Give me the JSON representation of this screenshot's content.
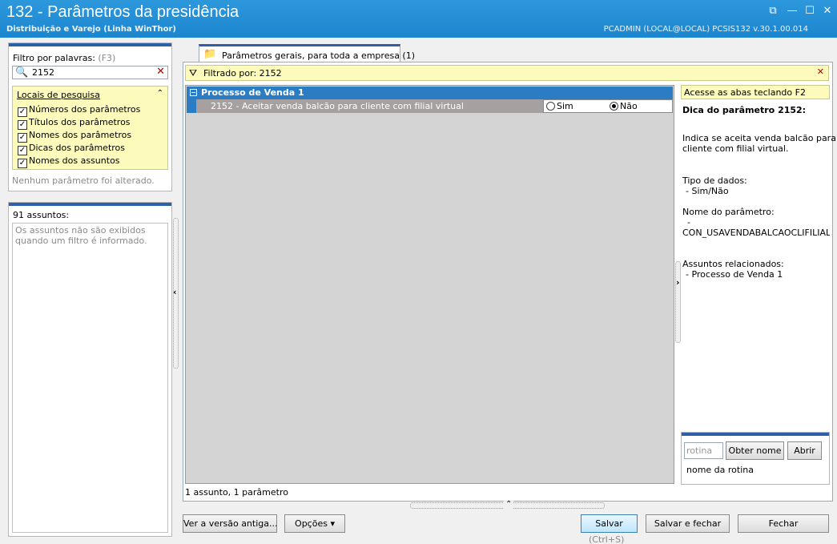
{
  "window": {
    "title": "132 - Parâmetros da presidência",
    "subtitle": "Distribuição e Varejo (Linha WinThor)",
    "user_info": "PCADMIN (LOCAL@LOCAL)   PCSIS132  v.30.1.00.014",
    "btn_restore": "⧉",
    "btn_minimize": "—",
    "btn_maximize": "☐",
    "btn_close": "✕"
  },
  "filter": {
    "label": "Filtro por palavras:",
    "shortcut": "(F3)",
    "search_value": "2152",
    "clear_glyph": "✕",
    "search_glyph": "🔍",
    "locations_header": "Locais de pesquisa",
    "collapse_glyph": "⌃",
    "locations": [
      {
        "label": "Números dos parâmetros",
        "checked": true
      },
      {
        "label": "Títulos dos parâmetros",
        "checked": true
      },
      {
        "label": "Nomes dos parâmetros",
        "checked": true
      },
      {
        "label": "Dicas dos parâmetros",
        "checked": true
      },
      {
        "label": "Nomes dos assuntos",
        "checked": true
      }
    ],
    "check_glyph": "✓",
    "no_change": "Nenhum parâmetro foi alterado."
  },
  "topics": {
    "count_label": "91 assuntos:",
    "message": "Os assuntos não são exibidos quando um filtro é informado."
  },
  "tab": {
    "label": "Parâmetros gerais, para toda a empresa  (1)",
    "icon": "📁"
  },
  "filterbar": {
    "text": "Filtrado por: 2152",
    "icon": "⛛",
    "close": "✕"
  },
  "grid": {
    "group_label": "Processo de Venda 1",
    "group_expander": "−",
    "param_label": "2152 - Aceitar venda balcão para cliente com filial virtual",
    "option_yes": "Sim",
    "option_no": "Não",
    "selected": "Não"
  },
  "status": "1 assunto, 1 parâmetro",
  "hint": {
    "tip": "Acesse as abas teclando F2",
    "title": "Dica do parâmetro 2152:",
    "description_1": "Indica se aceita venda balcão para",
    "description_2": "cliente com filial virtual.",
    "data_type_label": "Tipo de dados:",
    "data_type_value": "- Sim/Não",
    "param_name_label": "Nome do parâmetro:",
    "param_name_dash": "-",
    "param_name_value": "CON_USAVENDABALCAOCLIFILIALVIF",
    "related_label": "Assuntos relacionados:",
    "related_value": "- Processo de Venda 1"
  },
  "routine": {
    "placeholder": "rotina",
    "get_name": "Obter nome",
    "open": "Abrir",
    "name_label": "nome da rotina"
  },
  "buttons": {
    "old_version": "Ver a versão antiga...",
    "options": "Opções ▾",
    "save": "Salvar",
    "save_shortcut": "(Ctrl+S)",
    "save_close": "Salvar e fechar",
    "close": "Fechar"
  },
  "splitter_glyphs": {
    "left": "‹",
    "right": "›",
    "up": "⌃"
  }
}
